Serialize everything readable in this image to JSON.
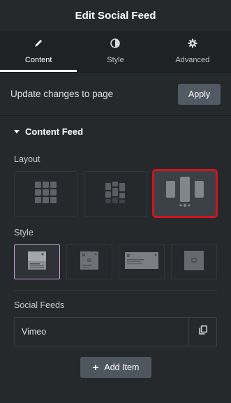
{
  "header": {
    "title": "Edit Social Feed"
  },
  "tabs": [
    {
      "label": "Content",
      "icon": "pencil-icon",
      "active": true
    },
    {
      "label": "Style",
      "icon": "half-circle-icon",
      "active": false
    },
    {
      "label": "Advanced",
      "icon": "gear-icon",
      "active": false
    }
  ],
  "update": {
    "text": "Update changes to page",
    "button_label": "Apply"
  },
  "content_feed": {
    "section_title": "Content Feed",
    "layout_label": "Layout",
    "layout_options": [
      {
        "name": "grid",
        "selected": false
      },
      {
        "name": "masonry",
        "selected": false
      },
      {
        "name": "carousel",
        "selected": true
      }
    ],
    "style_label": "Style",
    "style_options": [
      {
        "name": "style-1",
        "selected": true
      },
      {
        "name": "style-2",
        "selected": false
      },
      {
        "name": "style-3",
        "selected": false
      },
      {
        "name": "style-4",
        "selected": false
      }
    ],
    "social_feeds_label": "Social Feeds",
    "feeds": [
      {
        "name": "Vimeo"
      }
    ],
    "add_item_label": "Add Item"
  },
  "colors": {
    "background": "#26292c",
    "tab_bar": "#1f2124",
    "selected_outline": "#d1141c",
    "selected_style_border": "#c7a1d6",
    "button": "#515962"
  }
}
